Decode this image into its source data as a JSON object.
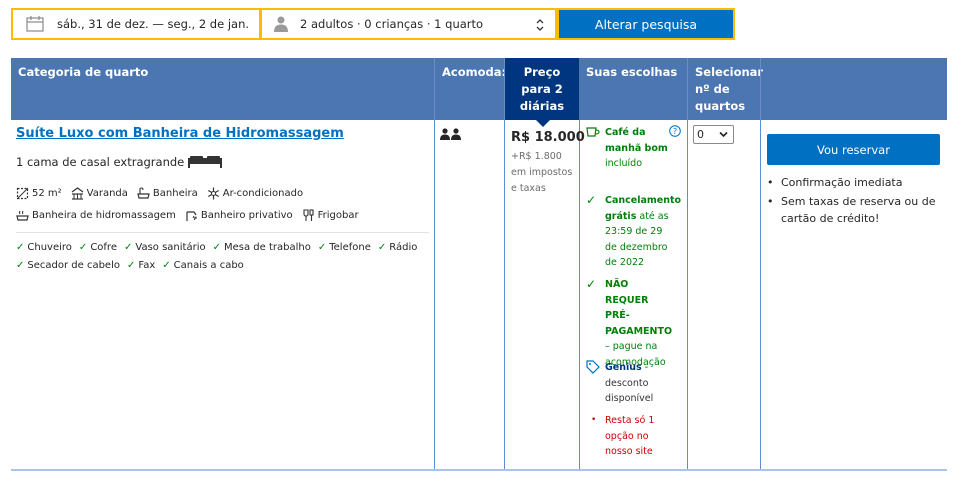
{
  "search": {
    "dates": "sáb., 31 de dez. — seg., 2 de jan.",
    "guests": "2 adultos  ·  0 crianças  ·  1 quarto",
    "button": "Alterar pesquisa"
  },
  "table": {
    "headers": {
      "room_type": "Categoria de quarto",
      "occupancy": "Acomoda:",
      "price": "Preço para 2 diárias",
      "choices": "Suas escolhas",
      "select": "Selecionar nº de quartos"
    }
  },
  "room": {
    "name": "Suíte Luxo com Banheira de Hidromassagem",
    "bed": "1 cama de casal extragrande",
    "features_row1": [
      {
        "icon": "area-icon",
        "label": "52 m²"
      },
      {
        "icon": "balcony-icon",
        "label": "Varanda"
      },
      {
        "icon": "bathtub-icon",
        "label": "Banheira"
      },
      {
        "icon": "air-conditioning-icon",
        "label": "Ar-condicionado"
      }
    ],
    "features_row2": [
      {
        "icon": "hot-tub-icon",
        "label": "Banheira de hidromassagem"
      },
      {
        "icon": "private-bathroom-icon",
        "label": "Banheiro privativo"
      },
      {
        "icon": "minibar-icon",
        "label": "Frigobar"
      }
    ],
    "amenities_row1": [
      "Chuveiro",
      "Cofre",
      "Vaso sanitário",
      "Mesa de trabalho",
      "Telefone",
      "Rádio"
    ],
    "amenities_row2": [
      "Secador de cabelo",
      "Fax",
      "Canais a cabo"
    ]
  },
  "price": {
    "amount": "R$ 18.000",
    "taxes": "+R$ 1.800 em impostos e taxas"
  },
  "choices": {
    "breakfast_bold": "Café da manhã bom",
    "breakfast_rest": "incluído",
    "cancel_bold": "Cancelamento grátis",
    "cancel_rest": " até as 23:59 de 29 de dezembro de 2022",
    "prepay_bold": "NÃO REQUER PRÉ-PAGAMENTO",
    "prepay_rest": "– pague na acomodação",
    "genius_bold": "Genius",
    "genius_rest": " - desconto disponível",
    "remaining": "Resta só 1 opção no nosso site"
  },
  "select": {
    "value": "0"
  },
  "reserve": {
    "button": "Vou reservar",
    "bullets": [
      "Confirmação imediata",
      "Sem taxas de reserva ou de cartão de crédito!"
    ]
  },
  "colors": {
    "header_bg": "#4c76b2",
    "price_header_bg": "#003580",
    "button_blue": "#0071c2",
    "search_border": "#febb02",
    "green": "#008009",
    "red": "#cc0000"
  }
}
